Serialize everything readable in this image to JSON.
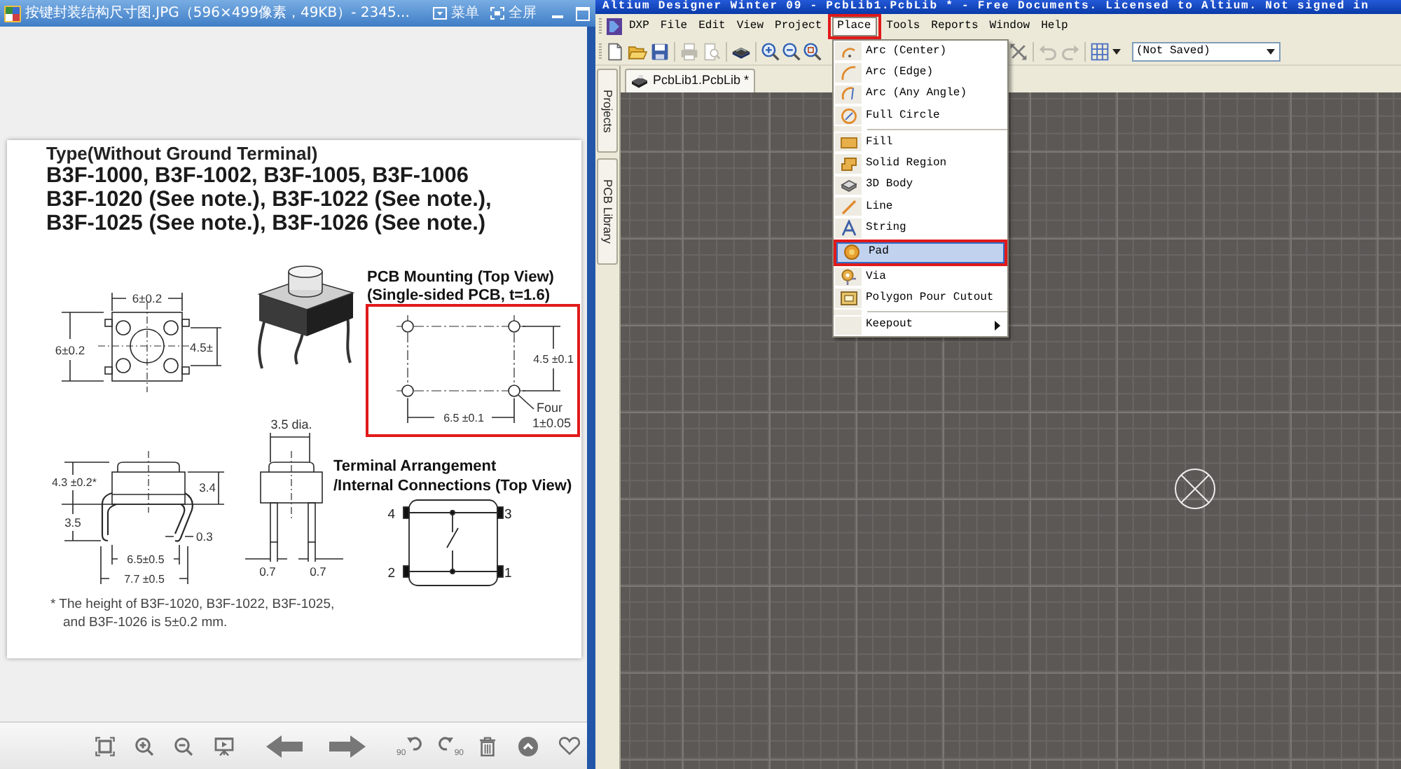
{
  "viewer": {
    "title": "按键封装结构尺寸图.JPG（596×499像素，49KB）- 2345...",
    "title_buttons": [
      {
        "label": "菜单"
      },
      {
        "label": "全屏"
      }
    ]
  },
  "document": {
    "heading": "Type(Without Ground Terminal)",
    "models": [
      "B3F-1000, B3F-1002, B3F-1005, B3F-1006",
      "B3F-1020 (See note.), B3F-1022 (See note.),",
      "B3F-1025 (See note.), B3F-1026 (See note.)"
    ],
    "top_view": {
      "width": "6±0.2",
      "height": "6±0.2",
      "pitch": "4.5±"
    },
    "pcb_mounting": {
      "title": "PCB Mounting (Top View)",
      "subtitle": "(Single-sided PCB, t=1.6)",
      "pitch": "4.5 ±0.1",
      "span": "6.5 ±0.1",
      "hole_note": [
        "Four",
        "1±0.05"
      ],
      "annotated": true
    },
    "side_view": {
      "height": "4.3 ±0.2*",
      "body": "3.4",
      "leg": "3.5",
      "lead": "0.3",
      "pitch": "6.5±0.5",
      "width": "7.7 ±0.5"
    },
    "front_view": {
      "diameter": "3.5 dia.",
      "leads": [
        "0.7",
        "0.7"
      ]
    },
    "terminals": {
      "title": [
        "Terminal Arrangement",
        "/Internal Connections (Top View)"
      ],
      "pins": [
        "4",
        "3",
        "2",
        "1"
      ]
    },
    "footnote": "* The height of B3F-1020, B3F-1022, B3F-1025, and B3F-1026 is 5±0.2 mm."
  },
  "viewer_toolbar": {
    "rotate_left_label": "90",
    "rotate_right_label": "90"
  },
  "altium": {
    "title": "Altium Designer Winter 09 - PcbLib1.PcbLib * - Free Documents. Licensed to Altium. Not signed in",
    "menu_bar": [
      {
        "label": "DXP",
        "selected": false,
        "annotated": false
      },
      {
        "label": "File",
        "selected": false,
        "annotated": false
      },
      {
        "label": "Edit",
        "selected": false,
        "annotated": false
      },
      {
        "label": "View",
        "selected": false,
        "annotated": false
      },
      {
        "label": "Project",
        "selected": false,
        "annotated": false
      },
      {
        "label": "Place",
        "selected": true,
        "annotated": true
      },
      {
        "label": "Tools",
        "selected": false,
        "annotated": false
      },
      {
        "label": "Reports",
        "selected": false,
        "annotated": false
      },
      {
        "label": "Window",
        "selected": false,
        "annotated": false
      },
      {
        "label": "Help",
        "selected": false,
        "annotated": false
      }
    ],
    "toolbar": [
      {
        "disabled": false
      },
      {
        "disabled": false
      },
      {
        "disabled": false
      },
      {
        "disabled": true
      },
      {
        "disabled": true
      },
      {
        "disabled": false
      },
      {
        "disabled": false
      },
      {
        "disabled": false
      },
      {
        "disabled": false
      },
      {
        "disabled": false
      },
      {
        "disabled": true
      },
      {
        "disabled": true
      },
      {
        "disabled": false
      }
    ],
    "snap_combo": "(Not Saved)",
    "side_tabs": [
      "Projects",
      "PCB Library"
    ],
    "document_tab": "PcbLib1.PcbLib *",
    "place_menu": [
      [
        {
          "label": "Arc (Center)",
          "selected": false,
          "annotated": false,
          "submenu": false
        },
        {
          "label": "Arc (Edge)",
          "selected": false,
          "annotated": false,
          "submenu": false
        },
        {
          "label": "Arc (Any Angle)",
          "selected": false,
          "annotated": false,
          "submenu": false
        },
        {
          "label": "Full Circle",
          "selected": false,
          "annotated": false,
          "submenu": false
        }
      ],
      [
        {
          "label": "Fill",
          "selected": false,
          "annotated": false,
          "submenu": false
        },
        {
          "label": "Solid Region",
          "selected": false,
          "annotated": false,
          "submenu": false
        },
        {
          "label": "3D Body",
          "selected": false,
          "annotated": false,
          "submenu": false
        },
        {
          "label": "Line",
          "selected": false,
          "annotated": false,
          "submenu": false
        },
        {
          "label": "String",
          "selected": false,
          "annotated": false,
          "submenu": false
        },
        {
          "label": "Pad",
          "selected": true,
          "annotated": true,
          "submenu": false
        },
        {
          "label": "Via",
          "selected": false,
          "annotated": false,
          "submenu": false
        },
        {
          "label": "Polygon Pour Cutout",
          "selected": false,
          "annotated": false,
          "submenu": false
        }
      ],
      [
        {
          "label": "Keepout",
          "selected": false,
          "annotated": false,
          "submenu": true
        }
      ]
    ]
  }
}
